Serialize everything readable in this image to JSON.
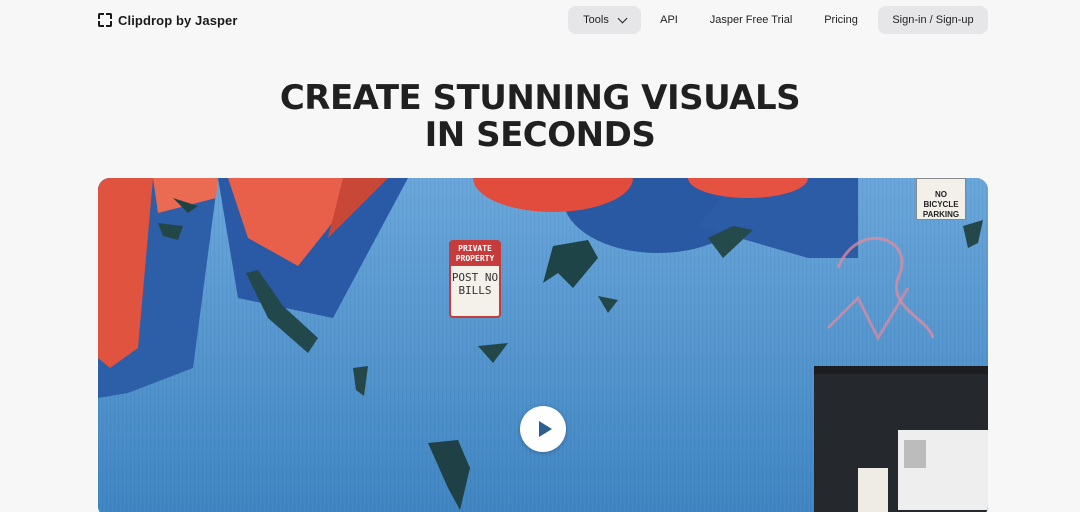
{
  "brand": {
    "name": "Clipdrop by Jasper"
  },
  "nav": {
    "tools": "Tools",
    "api": "API",
    "trial": "Jasper Free Trial",
    "pricing": "Pricing",
    "signin": "Sign-in / Sign-up"
  },
  "hero": {
    "line1": "CREATE STUNNING VISUALS",
    "line2": "IN SECONDS"
  },
  "video": {
    "sign_private_top": "PRIVATE PROPERTY",
    "sign_private_body": "POST NO BILLS",
    "sign_bike": "NO BICYCLE PARKING"
  },
  "icons": {
    "logo": "clipdrop-logo-icon",
    "tools_chevron": "chevron-down-icon",
    "play": "play-icon"
  }
}
